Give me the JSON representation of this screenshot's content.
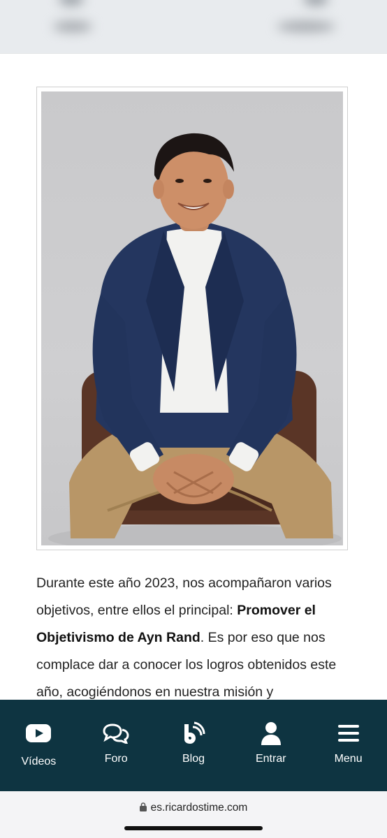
{
  "header": {
    "blurred": true
  },
  "photo": {
    "description_icon": "person-photo",
    "alt": ""
  },
  "article": {
    "p1_intro": "Durante este año 2023, nos acompañaron varios objetivos, entre ellos el principal: ",
    "p1_bold": "Promover el Objetivismo de Ayn Rand",
    "p1_rest": ". Es por eso que nos complace dar a conocer los logros obtenidos este año, acogiéndonos en nuestra misión y"
  },
  "nav": {
    "items": [
      {
        "label": "Vídeos",
        "icon": "youtube-icon"
      },
      {
        "label": "Foro",
        "icon": "chat-bubbles-icon"
      },
      {
        "label": "Blog",
        "icon": "blog-feed-icon"
      },
      {
        "label": "Entrar",
        "icon": "user-icon"
      },
      {
        "label": "Menu",
        "icon": "hamburger-icon"
      }
    ],
    "background": "#0e3441"
  },
  "browser": {
    "url": "es.ricardostime.com"
  }
}
